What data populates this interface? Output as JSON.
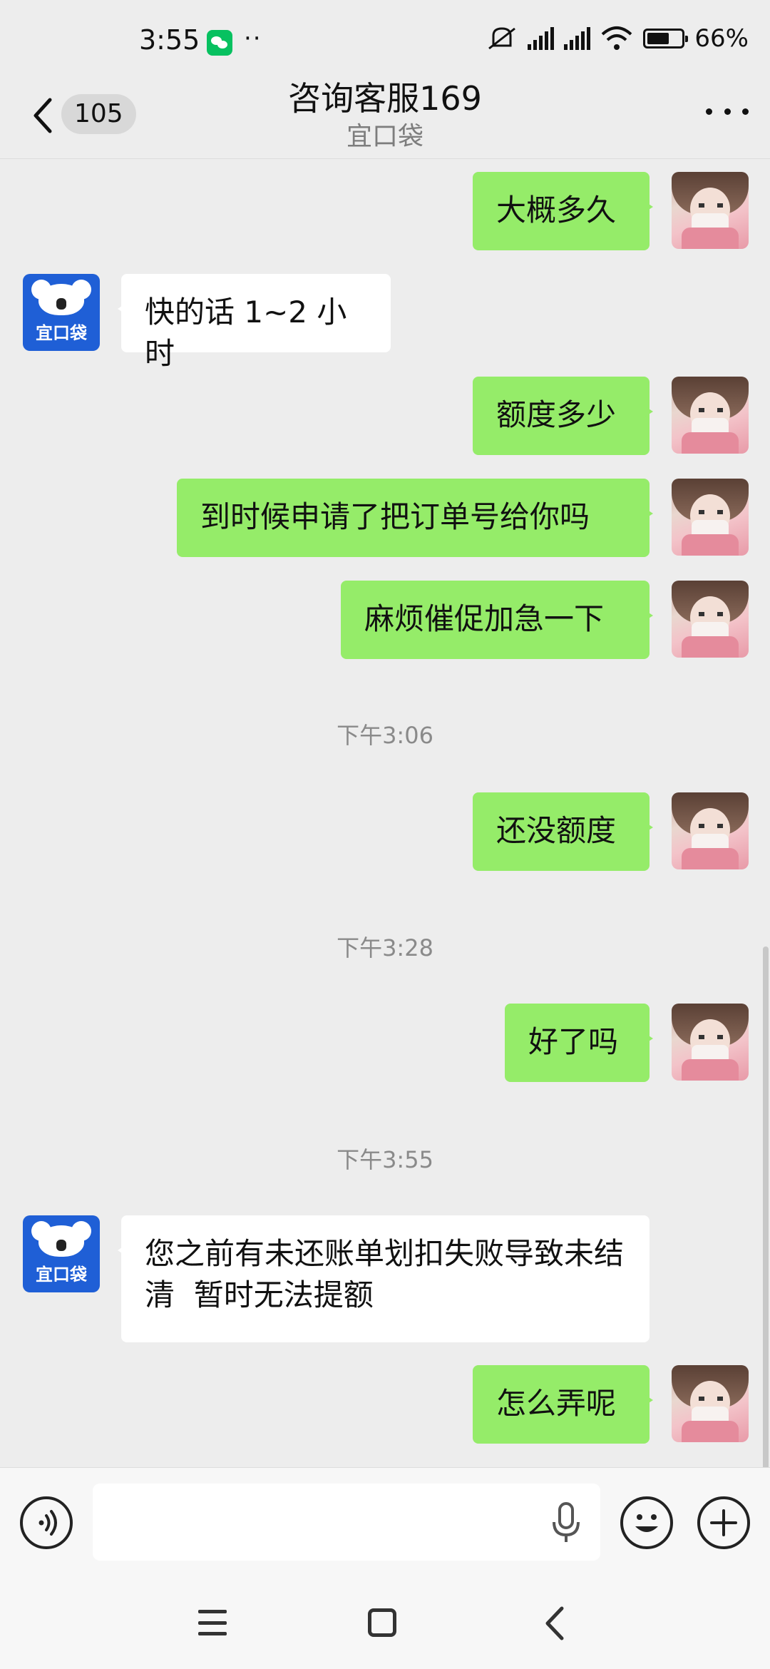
{
  "status_bar": {
    "time": "3:55",
    "dots": "··",
    "battery": "66%",
    "battery_level": 0.66,
    "icons": [
      "wechat-notification-icon",
      "mute-icon",
      "signal-hd-1-icon",
      "signal-hd-2-icon",
      "wifi-icon",
      "battery-icon"
    ]
  },
  "header": {
    "back_icon": "chevron-left-icon",
    "unread_count": "105",
    "title": "咨询客服169",
    "subtitle": "宜口袋",
    "more_icon": "more-dots-icon"
  },
  "messages": [
    {
      "side": "out",
      "text": "大概多久"
    },
    {
      "side": "in",
      "text": "快的话 1~2 小时"
    },
    {
      "side": "out",
      "text": "额度多少"
    },
    {
      "side": "out",
      "text": "到时候申请了把订单号给你吗"
    },
    {
      "side": "out",
      "text": "麻烦催促加急一下"
    },
    {
      "type": "time",
      "text": "下午3:06"
    },
    {
      "side": "out",
      "text": "还没额度"
    },
    {
      "type": "time",
      "text": "下午3:28"
    },
    {
      "side": "out",
      "text": "好了吗"
    },
    {
      "type": "time",
      "text": "下午3:55"
    },
    {
      "side": "in",
      "text": "您之前有未还账单划扣失败导致未结清  暂时无法提额"
    },
    {
      "side": "out",
      "text": "怎么弄呢"
    }
  ],
  "bot_avatar": {
    "label": "宜口袋",
    "colors": {
      "bg": "#1f5fd6"
    }
  },
  "input_bar": {
    "placeholder": "",
    "icons": [
      "voice-icon",
      "mic-icon",
      "emoji-icon",
      "plus-icon"
    ]
  },
  "nav_bar": {
    "icons": [
      "recent-apps-icon",
      "home-icon",
      "back-icon"
    ]
  },
  "colors": {
    "outgoing_bubble": "#95ec69",
    "incoming_bubble": "#ffffff",
    "background": "#ededed"
  }
}
